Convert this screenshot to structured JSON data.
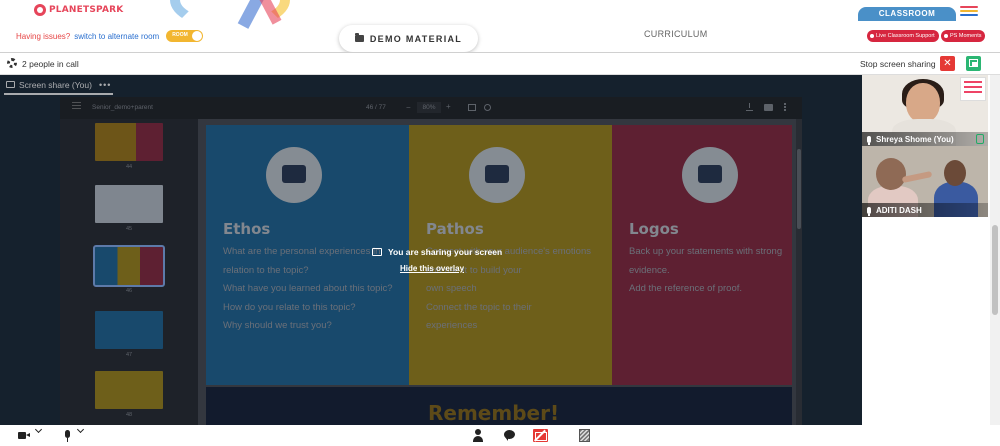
{
  "header": {
    "logo_text": "PLANETSPARK",
    "issue_text": "Having issues?",
    "switch_text": "switch to alternate room",
    "room_toggle_label": "ROOM",
    "demo_material_label": "DEMO MATERIAL",
    "curriculum_label": "CURRICULUM",
    "classroom_tab": "CLASSROOM",
    "live_support_label": "Live Classroom Support",
    "ps_moments_label": "PS Moments",
    "menu_colors": [
      "#e6455a",
      "#f2b630",
      "#2a6fcf"
    ]
  },
  "call_bar": {
    "people_text": "2 people in call",
    "stop_sharing_label": "Stop screen sharing",
    "close_label": "✕"
  },
  "share": {
    "tab_label": "Screen share (You)",
    "more_label": "•••",
    "overlay_message": "You are sharing your screen",
    "hide_overlay_label": "Hide this overlay"
  },
  "viewer": {
    "file_name": "Senior_demo+parent",
    "page_indicator": "46 / 77",
    "zoom_level": "80%",
    "thumbnails": [
      {
        "num": "44",
        "colors": [
          "#a47c1a",
          "#8d2a41"
        ]
      },
      {
        "num": "45",
        "colors": [
          "#bfc6cf",
          "#1d2b3a"
        ]
      },
      {
        "num": "46",
        "colors": [
          "#21699a",
          "#a58a1c",
          "#8d2a41"
        ],
        "selected": true
      },
      {
        "num": "47",
        "colors": [
          "#21699a",
          "#21699a"
        ]
      },
      {
        "num": "48",
        "colors": [
          "#a58a1c",
          "#a58a1c"
        ]
      }
    ],
    "slide": {
      "columns": [
        {
          "heading": "Ethos",
          "lines": [
            "What are the personal experiences in relation to the topic?",
            "What have you learned about this topic?",
            "How do you relate to this topic?",
            "Why should we trust you?"
          ]
        },
        {
          "heading": "Pathos",
          "lines": [
            "Connect with your audience's emotions",
            "and use it to build your",
            "own speech",
            "Connect the topic to their",
            "experiences"
          ]
        },
        {
          "heading": "Logos",
          "lines": [
            "Back up your statements with strong evidence.",
            "Add the reference of proof."
          ]
        }
      ],
      "footer_title": "Remember!"
    }
  },
  "participants": [
    {
      "name": "Shreya Shome (You)"
    },
    {
      "name": "ADITI DASH"
    }
  ],
  "colors": {
    "accent_red": "#e53935",
    "accent_green": "#2bb673",
    "brand_blue": "#4a90c8",
    "share_background": "#1d2b3a"
  },
  "icons": [
    "gear-icon",
    "screen-share-icon",
    "close-icon",
    "pip-icon",
    "camera-icon",
    "mic-icon",
    "participants-icon",
    "chat-icon",
    "stop-share-icon",
    "whiteboard-icon"
  ]
}
